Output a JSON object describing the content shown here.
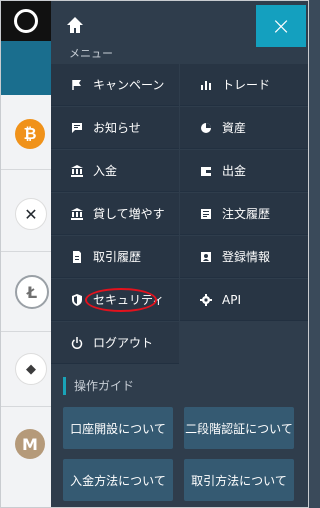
{
  "header": {
    "close_glyph": "×"
  },
  "menu": {
    "title": "メニュー",
    "items": [
      {
        "label": "キャンペーン",
        "icon": "flag-icon"
      },
      {
        "label": "トレード",
        "icon": "bar-chart-icon"
      },
      {
        "label": "お知らせ",
        "icon": "message-icon"
      },
      {
        "label": "資産",
        "icon": "pie-chart-icon"
      },
      {
        "label": "入金",
        "icon": "bank-icon"
      },
      {
        "label": "出金",
        "icon": "wallet-icon"
      },
      {
        "label": "貸して増やす",
        "icon": "bank-icon"
      },
      {
        "label": "注文履歴",
        "icon": "list-icon"
      },
      {
        "label": "取引履歴",
        "icon": "document-icon"
      },
      {
        "label": "登録情報",
        "icon": "user-card-icon"
      },
      {
        "label": "セキュリティ",
        "icon": "shield-icon"
      },
      {
        "label": "API",
        "icon": "gear-icon"
      },
      {
        "label": "ログアウト",
        "icon": "power-icon"
      }
    ]
  },
  "guide": {
    "title": "操作ガイド",
    "buttons": [
      {
        "label": "口座開設について"
      },
      {
        "label": "二段階認証について"
      },
      {
        "label": "入金方法について"
      },
      {
        "label": "取引方法について"
      }
    ]
  },
  "background": {
    "coins": [
      {
        "glyph": "₿",
        "color": "#f0921a"
      },
      {
        "glyph": "✕",
        "color": "#23292f"
      },
      {
        "glyph": "Ł",
        "color": "#9aa0a6"
      },
      {
        "glyph": "◆",
        "color": "#555a60"
      },
      {
        "glyph": "M",
        "color": "#b59a7a"
      }
    ]
  },
  "colors": {
    "accent": "#14a0bf",
    "panel": "#2f3d4c",
    "highlight": "#e3121d"
  }
}
